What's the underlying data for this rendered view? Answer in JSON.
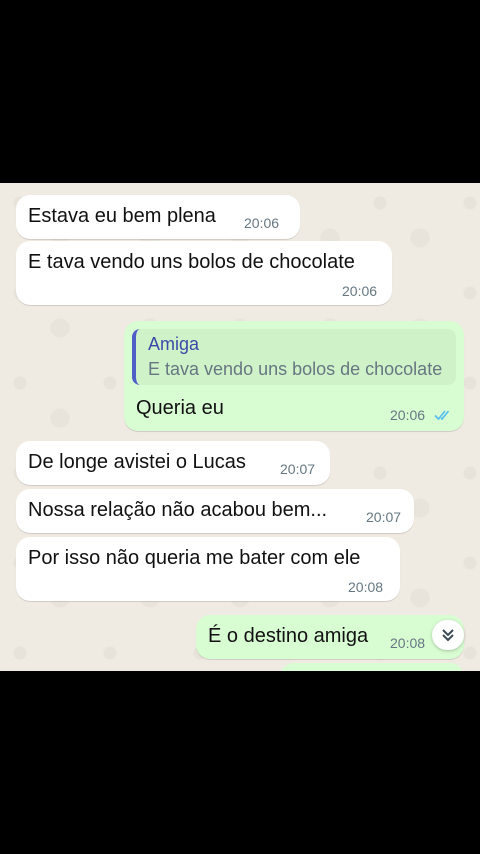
{
  "messages": [
    {
      "direction": "incoming",
      "text": "Estava eu bem plena",
      "time": "20:06"
    },
    {
      "direction": "incoming",
      "text": "E tava vendo uns bolos de chocolate",
      "time": "20:06"
    },
    {
      "direction": "outgoing",
      "quote": {
        "author": "Amiga",
        "text": "E tava vendo uns bolos de chocolate"
      },
      "text": "Queria eu",
      "time": "20:06",
      "status": "read"
    },
    {
      "direction": "incoming",
      "text": "De longe avistei o Lucas",
      "time": "20:07"
    },
    {
      "direction": "incoming",
      "text": "Nossa relação não acabou bem...",
      "time": "20:07"
    },
    {
      "direction": "incoming",
      "text": "Por isso não queria me bater com ele",
      "time": "20:08"
    },
    {
      "direction": "outgoing",
      "text": "É o destino amiga",
      "time": "20:08"
    }
  ],
  "colors": {
    "incoming_bubble": "#ffffff",
    "outgoing_bubble": "#d9fdd3",
    "read_ticks": "#53bdeb",
    "chat_background": "#efeae2"
  },
  "icons": {
    "scroll_down": "double-chevron-down-icon",
    "read_status": "double-check-icon"
  }
}
